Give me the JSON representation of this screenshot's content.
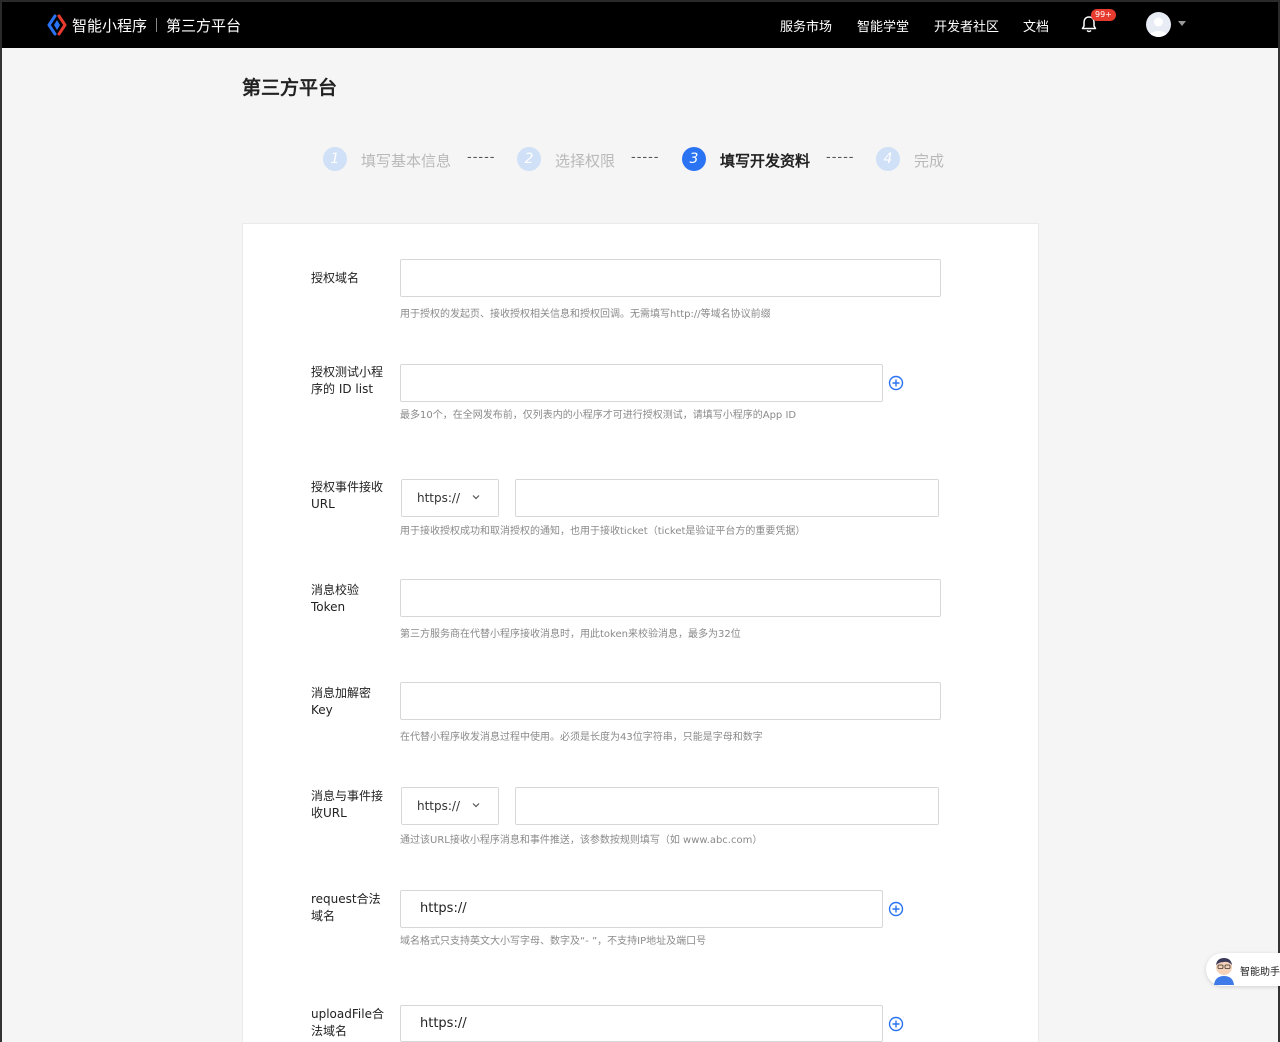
{
  "header": {
    "brand_name": "智能小程序",
    "brand_sub": "第三方平台",
    "nav": [
      "服务市场",
      "智能学堂",
      "开发者社区",
      "文档"
    ],
    "notification_count": "99+"
  },
  "page": {
    "title": "第三方平台"
  },
  "steps": [
    {
      "num": "1",
      "label": "填写基本信息"
    },
    {
      "num": "2",
      "label": "选择权限"
    },
    {
      "num": "3",
      "label": "填写开发资料"
    },
    {
      "num": "4",
      "label": "完成"
    }
  ],
  "step_dash": "-----",
  "current_step": 3,
  "form": {
    "auth_domain": {
      "label": "授权域名",
      "value": "",
      "hint": "用于授权的发起页、接收授权相关信息和授权回调。无需填写http://等域名协议前缀"
    },
    "test_ids": {
      "label": "授权测试小程序的 ID list",
      "value": "",
      "hint": "最多10个，在全网发布前，仅列表内的小程序才可进行授权测试，请填写小程序的App ID"
    },
    "event_url": {
      "label": "授权事件接收URL",
      "protocol": "https://",
      "value": "",
      "hint": "用于接收授权成功和取消授权的通知，也用于接收ticket（ticket是验证平台方的重要凭据）"
    },
    "token": {
      "label": "消息校验Token",
      "value": "",
      "hint": "第三方服务商在代替小程序接收消息时，用此token来校验消息，最多为32位"
    },
    "aes_key": {
      "label": "消息加解密Key",
      "value": "",
      "hint": "在代替小程序收发消息过程中使用。必须是长度为43位字符串，只能是字母和数字"
    },
    "msg_url": {
      "label": "消息与事件接收URL",
      "protocol": "https://",
      "value": "",
      "hint": "通过该URL接收小程序消息和事件推送，该参数按规则填写（如 www.abc.com）"
    },
    "request_domain": {
      "label": "request合法域名",
      "value": "https://",
      "hint": "域名格式只支持英文大小写字母、数字及“- ”，不支持IP地址及端口号"
    },
    "upload_domain": {
      "label": "uploadFile合法域名",
      "value": "https://"
    }
  },
  "assistant": {
    "label": "智能助手"
  },
  "colors": {
    "accent": "#2a73f3",
    "step_todo": "#cfe0f7",
    "topbar": "#000000"
  }
}
